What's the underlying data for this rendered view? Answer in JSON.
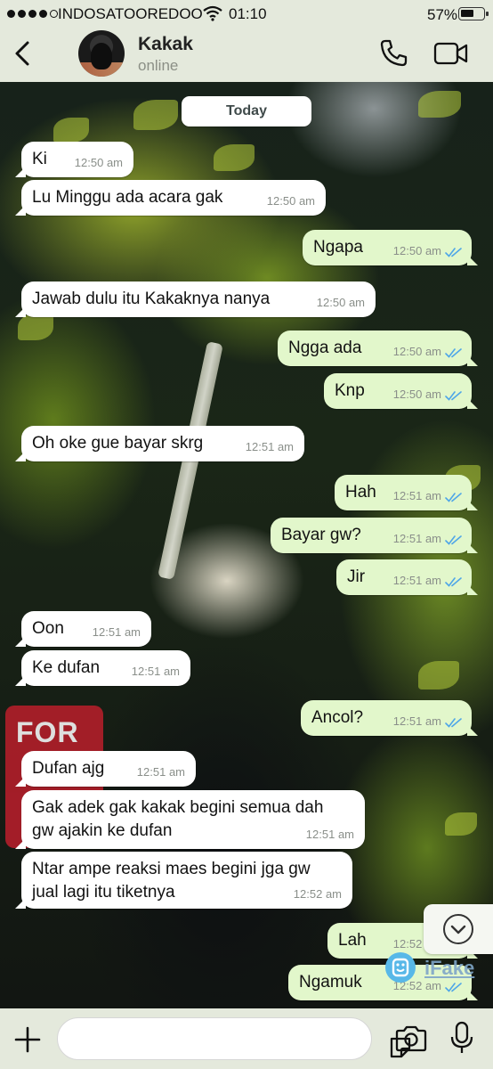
{
  "status_bar": {
    "carrier": "INDOSATOOREDOO",
    "time": "01:10",
    "battery": "57%",
    "battery_level": 0.57
  },
  "header": {
    "contact_name": "Kakak",
    "contact_status": "online"
  },
  "day_label": "Today",
  "messages": [
    {
      "dir": "in",
      "text": "Ki",
      "time": "12:50 am"
    },
    {
      "dir": "in",
      "text": "Lu Minggu ada acara gak",
      "time": "12:50 am"
    },
    {
      "dir": "out",
      "text": "Ngapa",
      "time": "12:50 am",
      "read": true
    },
    {
      "dir": "in",
      "text": "Jawab dulu itu Kakaknya nanya",
      "time": "12:50 am"
    },
    {
      "dir": "out",
      "text": "Ngga ada",
      "time": "12:50 am",
      "read": true
    },
    {
      "dir": "out",
      "text": "Knp",
      "time": "12:50 am",
      "read": true
    },
    {
      "dir": "in",
      "text": "Oh oke gue bayar skrg",
      "time": "12:51 am"
    },
    {
      "dir": "out",
      "text": "Hah",
      "time": "12:51 am",
      "read": true
    },
    {
      "dir": "out",
      "text": "Bayar gw?",
      "time": "12:51 am",
      "read": true
    },
    {
      "dir": "out",
      "text": "Jir",
      "time": "12:51 am",
      "read": true
    },
    {
      "dir": "in",
      "text": "Oon",
      "time": "12:51 am"
    },
    {
      "dir": "in",
      "text": "Ke dufan",
      "time": "12:51 am"
    },
    {
      "dir": "out",
      "text": "Ancol?",
      "time": "12:51 am",
      "read": true
    },
    {
      "dir": "in",
      "text": "Dufan ajg",
      "time": "12:51 am"
    },
    {
      "dir": "in",
      "text": "Gak adek gak kakak begini semua dah\ngw ajakin ke dufan",
      "time": "12:51 am"
    },
    {
      "dir": "in",
      "text": "Ntar ampe reaksi maes begini jga gw\njual lagi itu tiketnya",
      "time": "12:52 am"
    },
    {
      "dir": "out",
      "text": "Lah",
      "time": "12:52 am",
      "read": true
    },
    {
      "dir": "out",
      "text": "Ngamuk",
      "time": "12:52 am",
      "read": true
    }
  ],
  "composer": {
    "placeholder": ""
  },
  "wallpaper": {
    "shirt_text": "FOR"
  },
  "watermark": {
    "text": "iFake"
  },
  "colors": {
    "incoming_bubble": "#ffffff",
    "outgoing_bubble": "#e2f7cb",
    "read_ticks": "#4fa6e8",
    "bar_bg": "#e4e9dc"
  },
  "icons": [
    "back-arrow-icon",
    "phone-icon",
    "video-camera-icon",
    "plus-icon",
    "sticker-icon",
    "camera-icon",
    "microphone-icon",
    "chevron-down-icon"
  ]
}
